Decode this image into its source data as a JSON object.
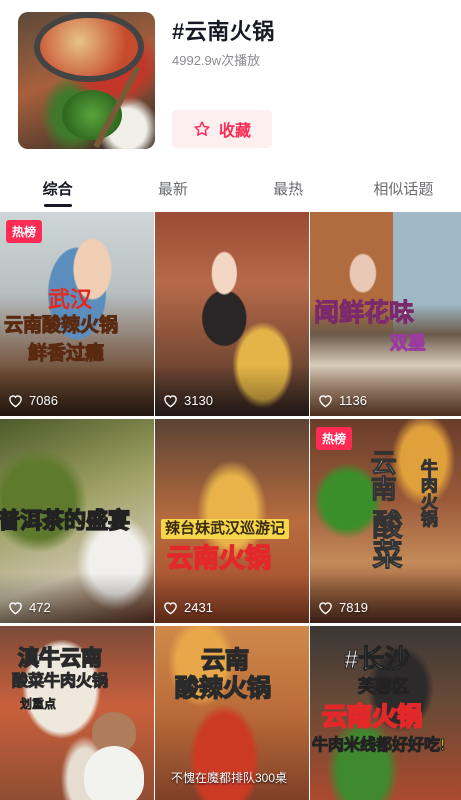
{
  "header": {
    "title": "#云南火锅",
    "plays": "4992.9w次播放",
    "favorite_label": "收藏"
  },
  "tabs": [
    {
      "label": "综合",
      "active": true
    },
    {
      "label": "最新",
      "active": false
    },
    {
      "label": "最热",
      "active": false
    },
    {
      "label": "相似话题",
      "active": false
    }
  ],
  "colors": {
    "accent": "#fe2c55",
    "text_primary": "#161823",
    "text_secondary": "#8a8b91"
  },
  "videos": [
    {
      "badge": "热榜",
      "likes": "7086",
      "captions": [
        "武汉",
        "云南酸辣火锅",
        "鲜香过瘾"
      ]
    },
    {
      "badge": "",
      "likes": "3130",
      "captions": []
    },
    {
      "badge": "",
      "likes": "1136",
      "captions": [
        "闻鲜花味",
        "双星"
      ]
    },
    {
      "badge": "",
      "likes": "472",
      "captions": [
        "普洱茶的盛宴"
      ]
    },
    {
      "badge": "",
      "likes": "2431",
      "captions": [
        "辣台妹武汉巡游记",
        "云南火锅"
      ]
    },
    {
      "badge": "热榜",
      "likes": "7819",
      "captions": [
        "云南",
        "酸菜",
        "牛肉火锅"
      ]
    },
    {
      "badge": "",
      "likes": "",
      "captions": [
        "滇牛云南",
        "酸菜牛肉火锅",
        "划重点"
      ]
    },
    {
      "badge": "",
      "likes": "",
      "captions": [
        "云南",
        "酸辣火锅",
        "不愧在魔都排队300桌"
      ]
    },
    {
      "badge": "",
      "likes": "",
      "captions": [
        "#长沙",
        "芙蓉区",
        "云南火锅",
        "牛肉米线都好好吃!"
      ]
    }
  ]
}
